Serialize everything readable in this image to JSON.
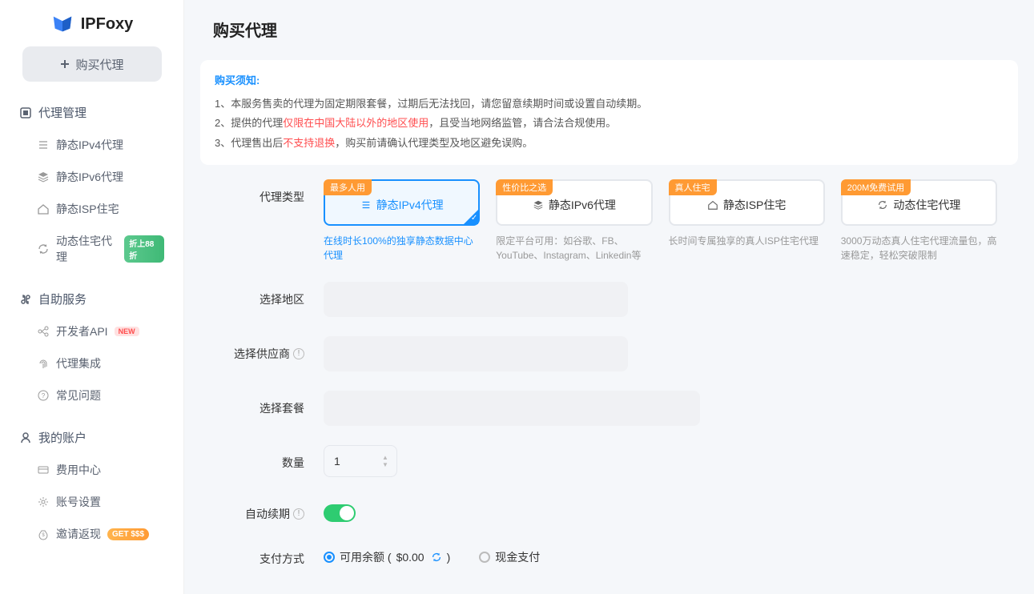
{
  "brand": "IPFoxy",
  "sidebar": {
    "buyBtn": "购买代理",
    "sections": [
      {
        "title": "代理管理",
        "items": [
          {
            "label": "静态IPv4代理",
            "badge": null
          },
          {
            "label": "静态IPv6代理",
            "badge": null
          },
          {
            "label": "静态ISP住宅",
            "badge": null
          },
          {
            "label": "动态住宅代理",
            "badge": "折上88折",
            "badgeType": "green"
          }
        ]
      },
      {
        "title": "自助服务",
        "items": [
          {
            "label": "开发者API",
            "badge": "NEW",
            "badgeType": "new"
          },
          {
            "label": "代理集成",
            "badge": null
          },
          {
            "label": "常见问题",
            "badge": null
          }
        ]
      },
      {
        "title": "我的账户",
        "items": [
          {
            "label": "费用中心",
            "badge": null
          },
          {
            "label": "账号设置",
            "badge": null
          },
          {
            "label": "邀请返现",
            "badge": "GET $$$",
            "badgeType": "get"
          }
        ]
      }
    ]
  },
  "page": {
    "title": "购买代理"
  },
  "notice": {
    "head": "购买须知:",
    "line1": "1、本服务售卖的代理为固定期限套餐，过期后无法找回，请您留意续期时间或设置自动续期。",
    "line2a": "2、提供的代理",
    "line2hl": "仅限在中国大陆以外的地区使用",
    "line2b": "，且受当地网络监管，请合法合规使用。",
    "line3a": "3、代理售出后",
    "line3hl": "不支持退换",
    "line3b": "，购买前请确认代理类型及地区避免误购。"
  },
  "form": {
    "labels": {
      "type": "代理类型",
      "region": "选择地区",
      "supplier": "选择供应商",
      "plan": "选择套餐",
      "qty": "数量",
      "renew": "自动续期",
      "pay": "支付方式"
    },
    "types": [
      {
        "tag": "最多人用",
        "label": "静态IPv4代理",
        "desc": "在线时长100%的独享静态数据中心代理",
        "active": true
      },
      {
        "tag": "性价比之选",
        "label": "静态IPv6代理",
        "desc": "限定平台可用：如谷歌、FB、YouTube、Instagram、Linkedin等",
        "active": false
      },
      {
        "tag": "真人住宅",
        "label": "静态ISP住宅",
        "desc": "长时间专属独享的真人ISP住宅代理",
        "active": false
      },
      {
        "tag": "200M免费试用",
        "label": "动态住宅代理",
        "desc": "3000万动态真人住宅代理流量包，高速稳定，轻松突破限制",
        "active": false
      }
    ],
    "qty": "1",
    "payOpts": {
      "balance": {
        "prefix": "可用余额 (",
        "amount": "$0.00",
        "suffix": ")"
      },
      "cash": "现金支付"
    }
  }
}
